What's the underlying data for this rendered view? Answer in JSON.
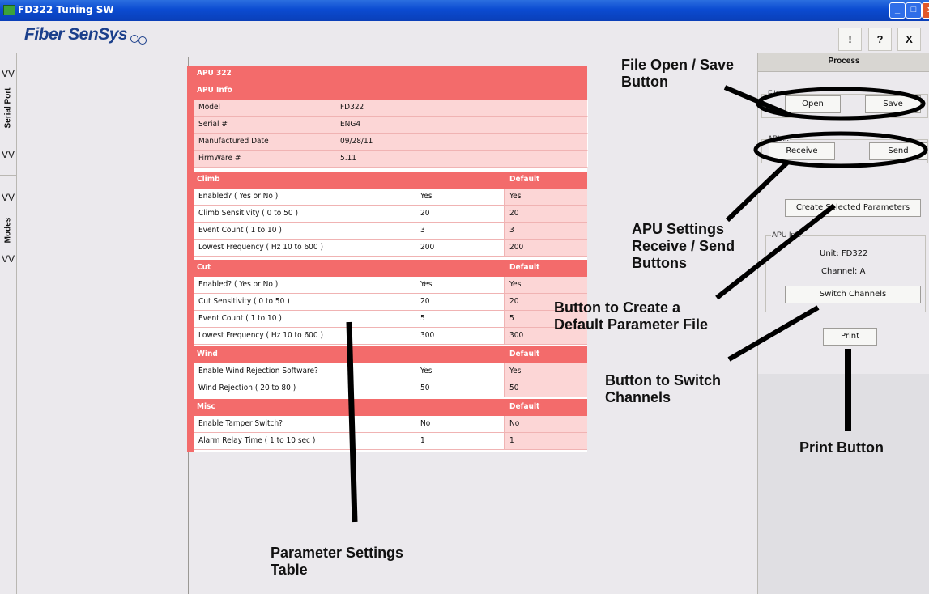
{
  "window": {
    "title": "FD322 Tuning SW",
    "controls": [
      "_",
      "□",
      "x"
    ]
  },
  "header": {
    "logo": "Fiber SenSys",
    "buttons": [
      "!",
      "?",
      "X"
    ]
  },
  "sidebar": {
    "tabs": [
      {
        "label": "Serial Port",
        "chevrons": [
          "VV",
          "VV"
        ]
      },
      {
        "label": "Modes",
        "chevrons": [
          "VV",
          "VV"
        ]
      }
    ]
  },
  "table": {
    "title": "APU 322",
    "info_header": "APU Info",
    "info": [
      {
        "label": "Model",
        "value": "FD322"
      },
      {
        "label": "Serial #",
        "value": "ENG4"
      },
      {
        "label": "Manufactured Date",
        "value": "09/28/11"
      },
      {
        "label": "FirmWare #",
        "value": "5.11"
      }
    ],
    "sections": [
      {
        "name": "Climb",
        "default_label": "Default",
        "rows": [
          {
            "label": "Enabled? ( Yes or No )",
            "value": "Yes",
            "default": "Yes"
          },
          {
            "label": "Climb Sensitivity ( 0 to 50 )",
            "value": "20",
            "default": "20"
          },
          {
            "label": "Event Count ( 1 to 10 )",
            "value": "3",
            "default": "3"
          },
          {
            "label": "Lowest Frequency ( Hz 10 to 600 )",
            "value": "200",
            "default": "200"
          }
        ]
      },
      {
        "name": "Cut",
        "default_label": "Default",
        "rows": [
          {
            "label": "Enabled? ( Yes or No )",
            "value": "Yes",
            "default": "Yes"
          },
          {
            "label": "Cut Sensitivity ( 0 to 50 )",
            "value": "20",
            "default": "20"
          },
          {
            "label": "Event Count ( 1 to 10 )",
            "value": "5",
            "default": "5"
          },
          {
            "label": "Lowest Frequency ( Hz 10 to 600 )",
            "value": "300",
            "default": "300"
          }
        ]
      },
      {
        "name": "Wind",
        "default_label": "Default",
        "rows": [
          {
            "label": "Enable Wind Rejection Software?",
            "value": "Yes",
            "default": "Yes"
          },
          {
            "label": "Wind Rejection ( 20 to 80 )",
            "value": "50",
            "default": "50"
          }
        ]
      },
      {
        "name": "Misc",
        "default_label": "Default",
        "rows": [
          {
            "label": "Enable Tamper Switch?",
            "value": "No",
            "default": "No"
          },
          {
            "label": "Alarm Relay Time ( 1 to 10 sec )",
            "value": "1",
            "default": "1"
          }
        ]
      }
    ]
  },
  "process": {
    "title": "Process",
    "file_group": "File...",
    "open": "Open",
    "save": "Save",
    "apu_group": "APU...",
    "receive": "Receive",
    "send": "Send",
    "create": "Create Selected Parameters",
    "apu_info_group": "APU Info",
    "unit": "Unit: FD322",
    "channel": "Channel: A",
    "switch": "Switch Channels",
    "print": "Print"
  },
  "annotations": {
    "file": "File Open / Save\nButton",
    "apu": "APU Settings\nReceive / Send\nButtons",
    "create": "Button to Create a\nDefault Parameter File",
    "switch": "Button to Switch\nChannels",
    "print": "Print Button",
    "table": "Parameter Settings\nTable"
  },
  "colors": {
    "table_header": "#f36b6b",
    "table_light": "#fcd6d6",
    "title_bar": "#0b4bd1"
  }
}
